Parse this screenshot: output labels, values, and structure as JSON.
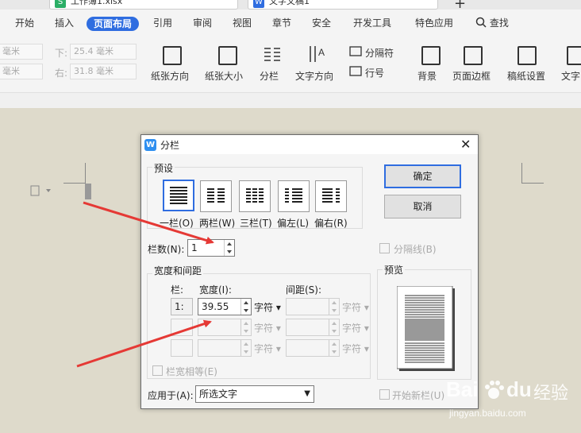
{
  "tabs": [
    {
      "label": "工作簿1.xlsx",
      "icon": "spreadsheet-icon"
    },
    {
      "label": "文字文稿1",
      "icon": "writer-icon"
    }
  ],
  "menu": {
    "items": [
      "开始",
      "插入",
      "页面布局",
      "引用",
      "审阅",
      "视图",
      "章节",
      "安全",
      "开发工具",
      "特色应用"
    ],
    "active": "页面布局",
    "search_label": "查找"
  },
  "ribbon": {
    "margin_top_value": "毫米",
    "margin_bottom_label": "下:",
    "margin_bottom_value": "25.4 毫米",
    "margin_left_value": "毫米",
    "margin_right_label": "右:",
    "margin_right_value": "31.8 毫米",
    "paper_orientation": "纸张方向",
    "paper_size": "纸张大小",
    "columns": "分栏",
    "text_direction": "文字方向",
    "separator": "分隔符",
    "line_number": "行号",
    "background": "背景",
    "page_border": "页面边框",
    "manuscript": "稿纸设置",
    "text_cut": "文字"
  },
  "dialog": {
    "title": "分栏",
    "preset_label": "预设",
    "presets": [
      "一栏(O)",
      "两栏(W)",
      "三栏(T)",
      "偏左(L)",
      "偏右(R)"
    ],
    "ok": "确定",
    "cancel": "取消",
    "col_count_label": "栏数(N):",
    "col_count_value": "1",
    "separator_label": "分隔线(B)",
    "width_spacing_label": "宽度和间距",
    "col_header": "栏:",
    "width_header": "宽度(I):",
    "spacing_header": "间距(S):",
    "rows": [
      {
        "num": "1:",
        "width": "39.55",
        "unit": "字符",
        "spacing": "",
        "unit2": "字符"
      },
      {
        "num": "",
        "width": "",
        "unit": "字符",
        "spacing": "",
        "unit2": "字符"
      },
      {
        "num": "",
        "width": "",
        "unit": "字符",
        "spacing": "",
        "unit2": "字符"
      }
    ],
    "equal_width_label": "栏宽相等(E)",
    "preview_label": "预览",
    "apply_label": "应用于(A):",
    "apply_value": "所选文字",
    "new_col_label": "开始新栏(U)"
  },
  "watermark": {
    "brand": "Bai",
    "brand2": "du",
    "jingyan": "经验",
    "url": "jingyan.baidu.com"
  },
  "colors": {
    "accent": "#2f6de0",
    "arrow": "#e53935"
  }
}
